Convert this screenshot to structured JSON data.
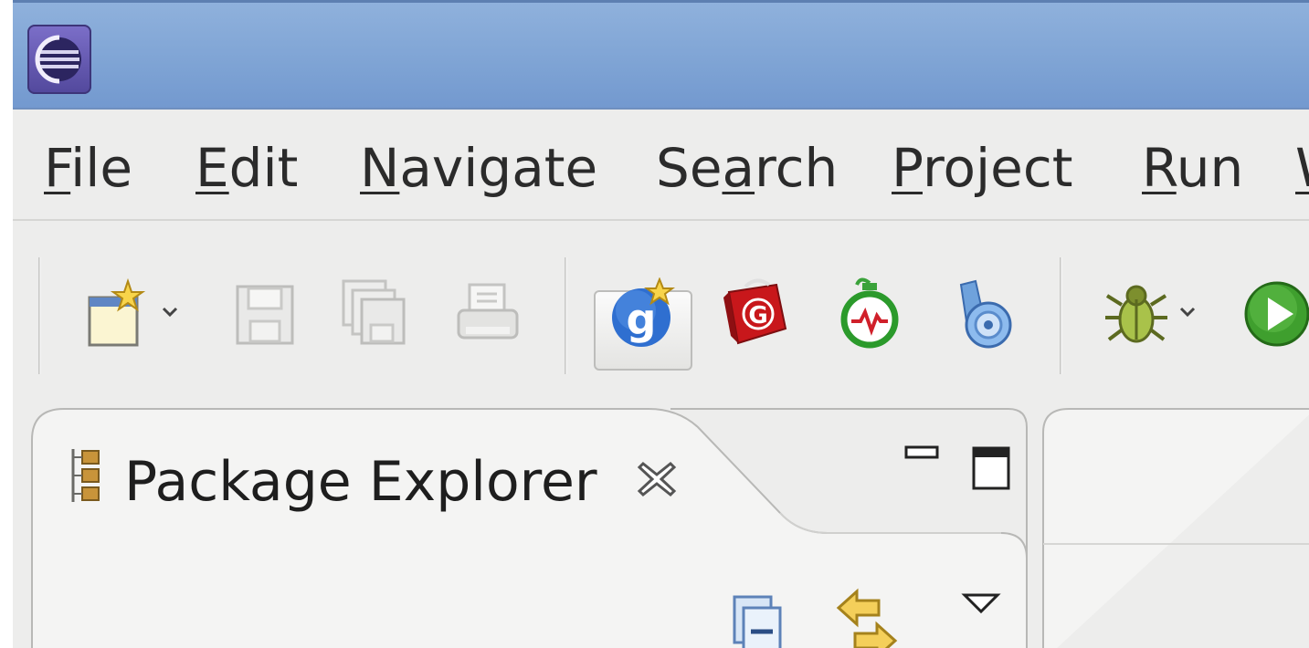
{
  "window": {
    "app_icon": "eclipse-icon"
  },
  "menubar": {
    "items": [
      {
        "mnemonic": "F",
        "rest": "ile"
      },
      {
        "mnemonic": "E",
        "rest": "dit"
      },
      {
        "mnemonic": "N",
        "rest": "avigate"
      },
      {
        "pre": "Se",
        "mnemonic": "a",
        "rest": "rch"
      },
      {
        "mnemonic": "P",
        "rest": "roject"
      },
      {
        "mnemonic": "R",
        "rest": "un"
      },
      {
        "mnemonic": "W",
        "rest": ""
      }
    ]
  },
  "toolbar": {
    "icons": [
      "new-wizard-icon",
      "save-icon",
      "save-all-icon",
      "print-icon",
      "google-plugin-icon",
      "gwt-icon",
      "profiler-icon",
      "speed-tracer-icon",
      "debug-icon",
      "run-icon"
    ]
  },
  "package_explorer": {
    "title": "Package Explorer",
    "icons": [
      "package-explorer-icon",
      "close-icon",
      "minimize-icon",
      "maximize-icon",
      "collapse-all-icon",
      "link-with-editor-icon",
      "view-menu-icon"
    ]
  },
  "colors": {
    "titlebar": "#7ea3d4",
    "menubar": "#ededec",
    "panel": "#ededec"
  }
}
